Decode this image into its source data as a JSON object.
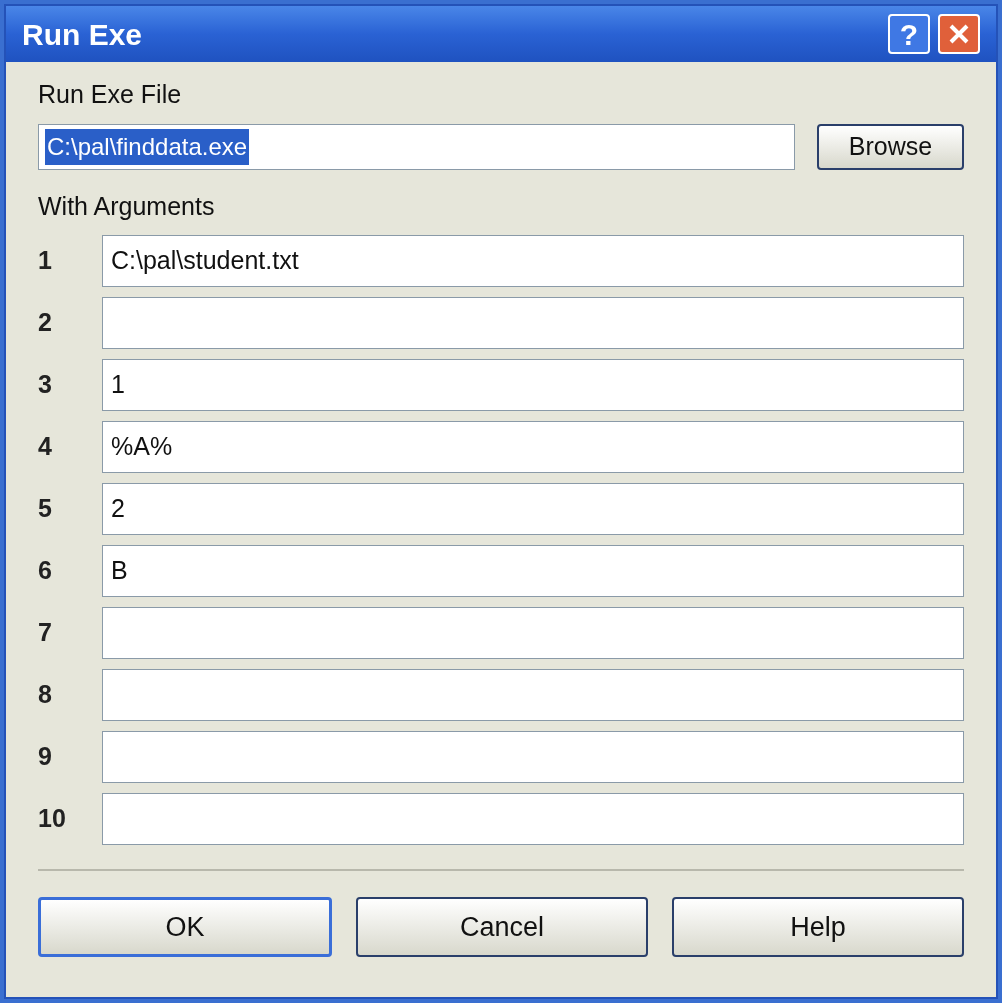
{
  "window": {
    "title": "Run Exe",
    "help_button": "?"
  },
  "exe_file": {
    "label": "Run Exe File",
    "value": "C:\\pal\\finddata.exe",
    "selected": true
  },
  "browse_button": "Browse",
  "arguments": {
    "label": "With Arguments",
    "rows": [
      {
        "number": "1",
        "value": "C:\\pal\\student.txt"
      },
      {
        "number": "2"
      },
      {
        "number": "3",
        "value": "1"
      },
      {
        "number": "4",
        "value": "%A%"
      },
      {
        "number": "5",
        "value": "2"
      },
      {
        "number": "6",
        "value": "B"
      },
      {
        "number": "7"
      },
      {
        "number": "8"
      },
      {
        "number": "9"
      },
      {
        "number": "10"
      }
    ]
  },
  "buttons": [
    {
      "label": "OK",
      "default": true
    },
    {
      "label": "Cancel",
      "default": false
    },
    {
      "label": "Help",
      "default": false
    }
  ]
}
